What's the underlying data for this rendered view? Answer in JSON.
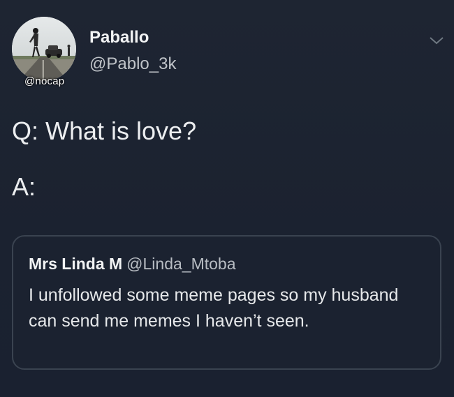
{
  "author": {
    "display_name": "Paballo",
    "handle": "@Pablo_3k",
    "avatar_watermark": "@nocap"
  },
  "tweet": {
    "line_q": "Q: What is love?",
    "line_a": "A:"
  },
  "quoted_tweet": {
    "display_name": "Mrs Linda  M",
    "handle": "@Linda_Mtoba",
    "text": "I unfollowed some meme pages so my husband can send me memes I haven’t seen."
  },
  "icons": {
    "menu": "chevron-down-icon"
  },
  "colors": {
    "background": "#1c2330",
    "text_primary": "#eceef0",
    "text_secondary": "#b8bdc3",
    "quote_border": "#3a4350"
  }
}
